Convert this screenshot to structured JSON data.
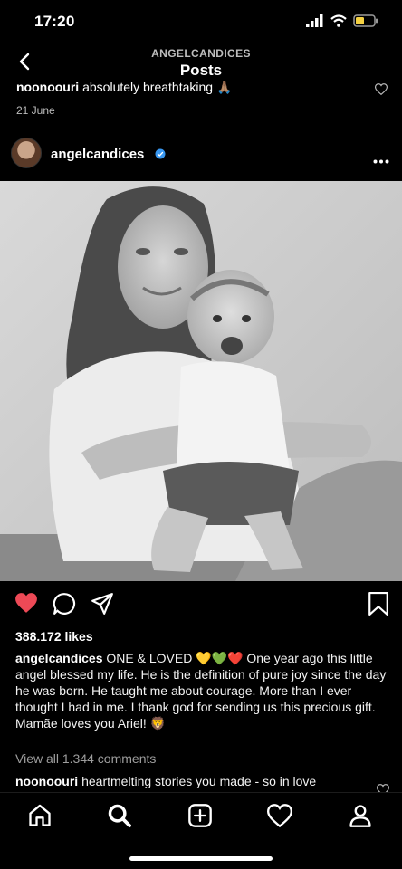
{
  "status": {
    "time": "17:20"
  },
  "header": {
    "account": "ANGELCANDICES",
    "title": "Posts"
  },
  "previous_comment": {
    "user": "noonoouri",
    "text": "absolutely breathtaking 🙏🏽",
    "date": "21 June"
  },
  "post": {
    "username": "angelcandices",
    "verified": true,
    "likes": "388.172 likes",
    "caption_user": "angelcandices",
    "caption_text": "ONE & LOVED 💛💚❤️ One year ago this little angel blessed my life. He is the definition of pure joy since the day he was born. He taught me about courage. More than I ever thought I had in me. I thank god for sending us this precious gift. Mamãe loves you Ariel! 🦁",
    "view_all": "View all 1.344 comments",
    "comment_user": "noonoouri",
    "comment_text": "heartmelting stories you made - so in love"
  },
  "icons": {
    "back": "chevron-left-icon",
    "more": "more-horizontal-icon",
    "like": "heart-filled-icon",
    "comment": "comment-icon",
    "share": "send-icon",
    "save": "bookmark-icon",
    "tabs": [
      "home-icon",
      "search-icon",
      "add-post-icon",
      "activity-heart-icon",
      "profile-icon"
    ]
  },
  "colors": {
    "like_red": "#ed4956",
    "verified_blue": "#3897f0",
    "battery_yellow": "#f5d142",
    "secondary_text": "#9e9e9e"
  }
}
